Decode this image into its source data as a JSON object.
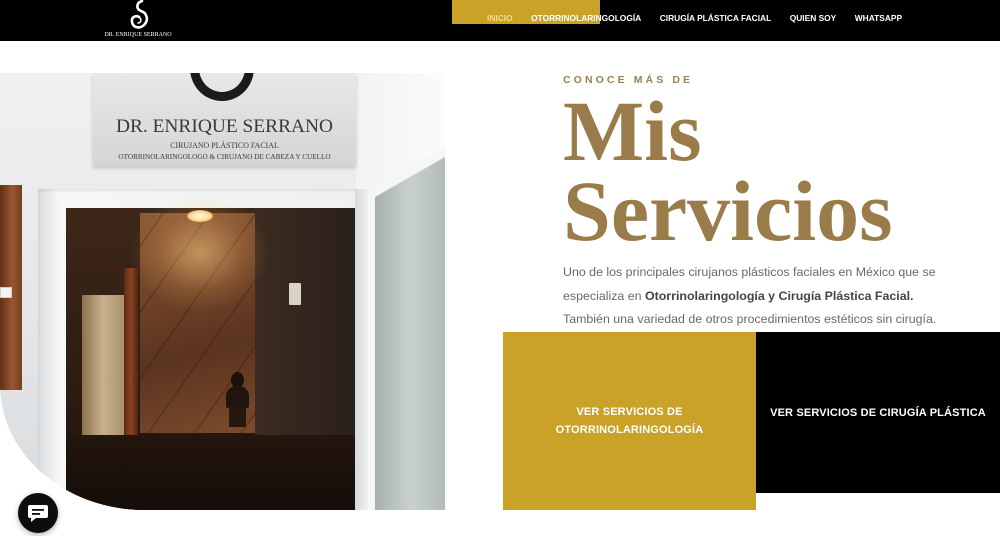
{
  "brand": {
    "logo_icon": "monogram-logo-icon",
    "name": "DR. ENRIQUE SERRANO"
  },
  "nav": {
    "items": [
      {
        "label": "INICIO",
        "active": true
      },
      {
        "label": "OTORRINOLARINGOLOGÍA",
        "active": false
      },
      {
        "label": "CIRUGÍA PLÁSTICA FACIAL",
        "active": false
      },
      {
        "label": "QUIEN SOY",
        "active": false
      },
      {
        "label": "WHATSAPP",
        "active": false
      }
    ]
  },
  "hero_photo": {
    "sign": {
      "name": "DR. ENRIQUE SERRANO",
      "title": "CIRUJANO PLÁSTICO FACIAL",
      "specialties": "OTORRINOLARINGOLOGO & CIRUJANO DE CABEZA Y CUELLO"
    }
  },
  "services": {
    "eyebrow": "CONOCE MÁS DE",
    "heading_line1": "Mis",
    "heading_line2": "Servicios",
    "intro": {
      "before": "Uno de los principales cirujanos plásticos faciales en México que se especializa en ",
      "bold": "Otorrinolaringología y Cirugía Plástica Facial.",
      "after": " También una variedad de otros procedimientos estéticos sin cirugía."
    },
    "buttons": [
      {
        "label": "VER SERVICIOS DE OTORRINOLARINGOLOGÍA"
      },
      {
        "label": "VER SERVICIOS DE CIRUGÍA PLÁSTICA"
      }
    ]
  },
  "chat_widget": {
    "icon": "chat-bubble-icon"
  },
  "colors": {
    "header_bg": "#000000",
    "gold": "#c9a227",
    "heading_brown": "#9a7c4b",
    "body_text": "#696969",
    "dark_button": "#000000"
  }
}
